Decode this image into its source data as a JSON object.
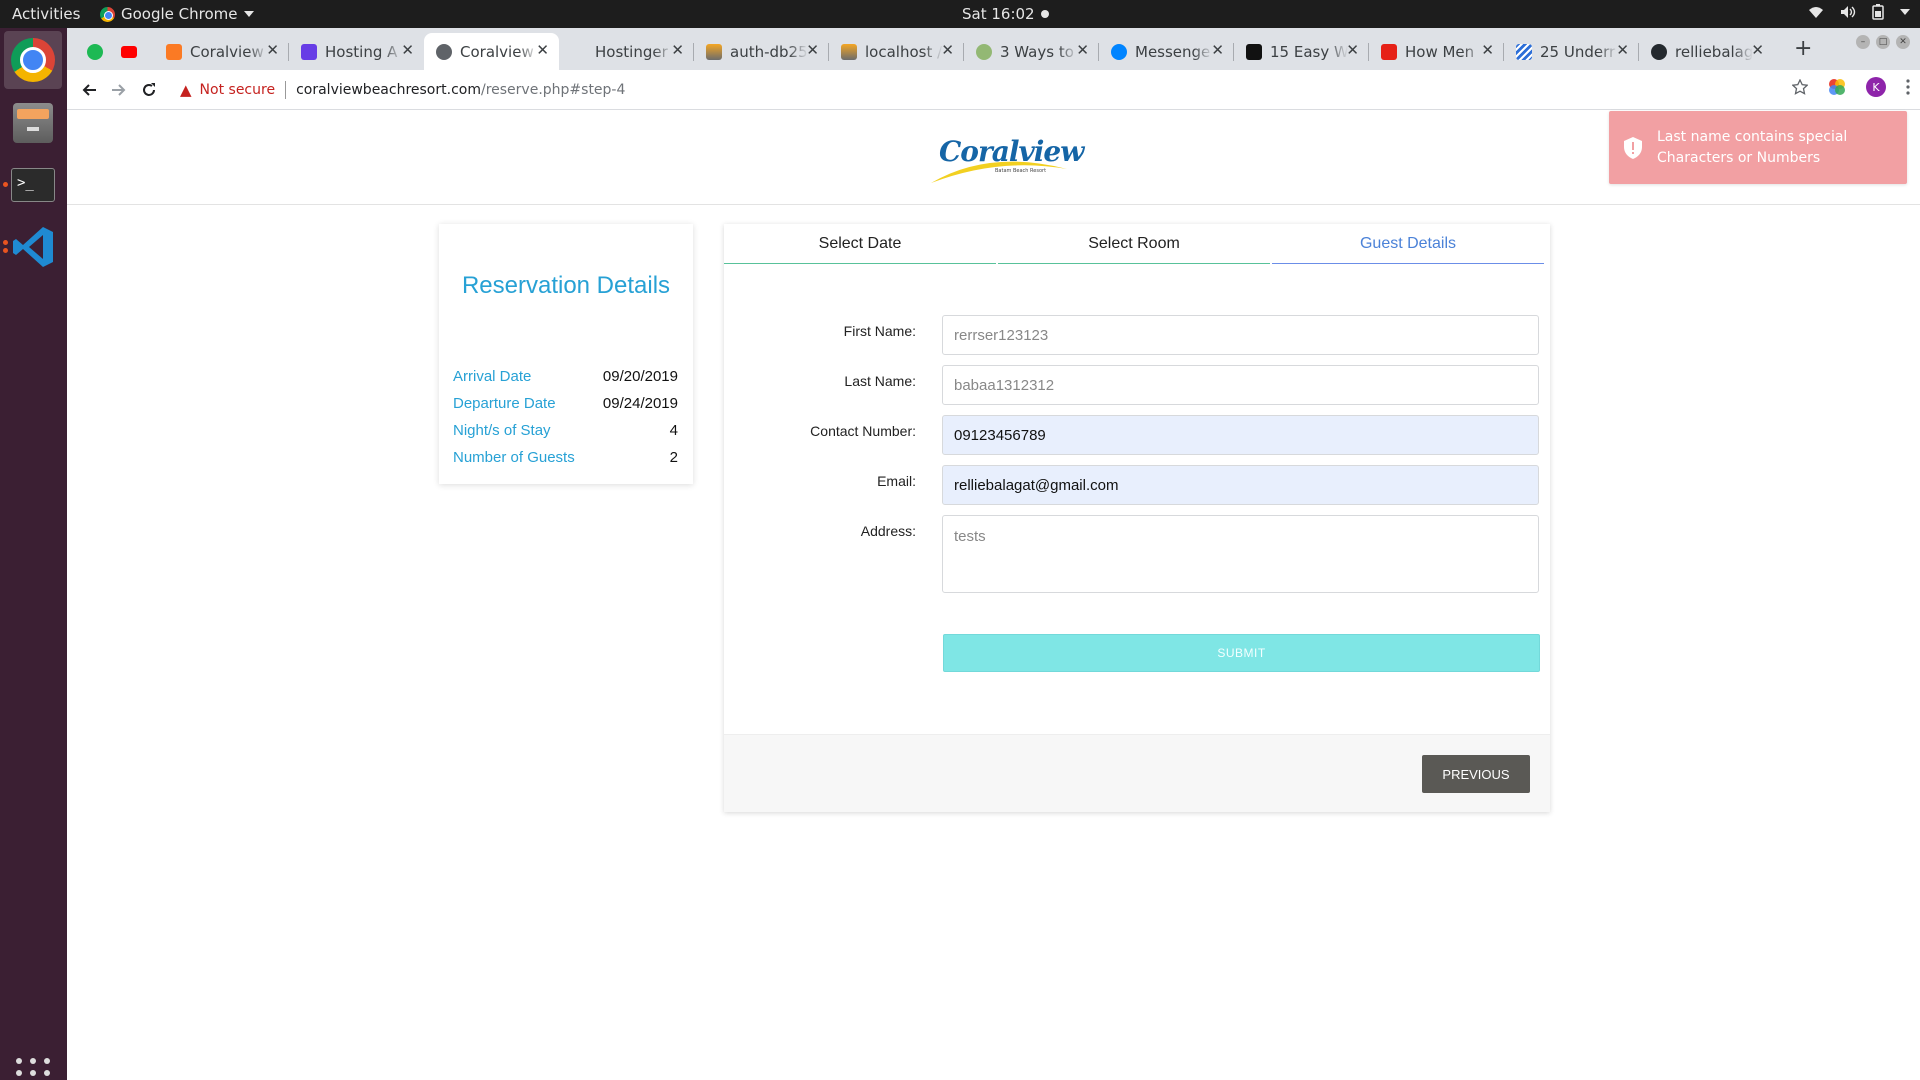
{
  "topbar": {
    "activities": "Activities",
    "app_name": "Google Chrome",
    "clock": "Sat 16:02"
  },
  "tabs": [
    {
      "label": "",
      "icon": "spotify-icon"
    },
    {
      "label": "",
      "icon": "youtube-icon"
    },
    {
      "label": "Coralview",
      "icon": "xampp-icon"
    },
    {
      "label": "Hosting A",
      "icon": "hostinger-icon"
    },
    {
      "label": "Coralview",
      "icon": "globe-icon",
      "active": true
    },
    {
      "label": "Hostinger",
      "icon": "blank-icon"
    },
    {
      "label": "auth-db25",
      "icon": "phpmyadmin-icon"
    },
    {
      "label": "localhost /",
      "icon": "phpmyadmin-icon"
    },
    {
      "label": "3 Ways to",
      "icon": "wikihow-icon"
    },
    {
      "label": "Messenge",
      "icon": "messenger-icon"
    },
    {
      "label": "15 Easy W",
      "icon": "article-icon"
    },
    {
      "label": "How Men",
      "icon": "news-icon"
    },
    {
      "label": "25 Underr",
      "icon": "stripes-icon"
    },
    {
      "label": "relliebalag",
      "icon": "github-icon"
    }
  ],
  "address": {
    "security_label": "Not secure",
    "host": "coralviewbeachresort.com",
    "path": "/reserve.php#step-4",
    "profile_initial": "K"
  },
  "logo": {
    "text": "Coralview",
    "subtitle": "Batam Beach Resort"
  },
  "toast": {
    "message": "Last name contains special Characters or Numbers",
    "color": "#f2a0a3"
  },
  "reservation": {
    "title": "Reservation Details",
    "rows": [
      {
        "label": "Arrival Date",
        "value": "09/20/2019"
      },
      {
        "label": "Departure Date",
        "value": "09/24/2019"
      },
      {
        "label": "Night/s of Stay",
        "value": "4"
      },
      {
        "label": "Number of Guests",
        "value": "2"
      }
    ]
  },
  "steps": [
    {
      "label": "Select Date"
    },
    {
      "label": "Select Room"
    },
    {
      "label": "Guest Details"
    }
  ],
  "form": {
    "first_name_label": "First Name:",
    "first_name_value": "rerrser123123",
    "last_name_label": "Last Name:",
    "last_name_value": "babaa1312312",
    "contact_label": "Contact Number:",
    "contact_value": "09123456789",
    "email_label": "Email:",
    "email_value": "relliebalagat@gmail.com",
    "address_label": "Address:",
    "address_value": "tests",
    "submit_label": "SUBMIT",
    "previous_label": "PREVIOUS"
  },
  "colors": {
    "accent_blue": "#27a1d5",
    "submit_cyan": "#7fe6e5",
    "dock_bg": "#3b1f33"
  }
}
